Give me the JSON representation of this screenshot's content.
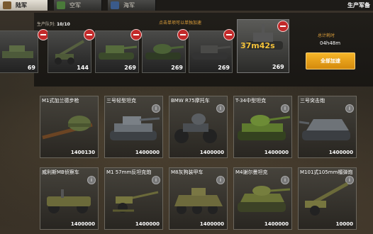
{
  "tabs": [
    {
      "label": "陆军",
      "active": true
    },
    {
      "label": "空军",
      "active": false
    },
    {
      "label": "海军",
      "active": false
    }
  ],
  "title": "生产军备",
  "queue": {
    "count_label": "生产队列:",
    "count_value": "10/10",
    "hint": "点击单项可以单独加速",
    "slots": [
      {
        "count": "69"
      },
      {
        "count": "144"
      },
      {
        "count": "269"
      },
      {
        "count": "269"
      },
      {
        "count": "269"
      }
    ],
    "active": {
      "timer": "37m42s",
      "count": "269"
    },
    "total_label": "总计耗时",
    "total_value": "04h48m",
    "speed_all_label": "全部加速"
  },
  "units": [
    {
      "name": "M1式加兰德步枪",
      "price": "1400130",
      "icon": "rifle-helmet-icon"
    },
    {
      "name": "三号轻型坦克",
      "price": "1400000",
      "icon": "light-tank-icon"
    },
    {
      "name": "BMW R75摩托车",
      "price": "1400000",
      "icon": "motorcycle-icon"
    },
    {
      "name": "T-34中型坦克",
      "price": "1400000",
      "icon": "medium-tank-icon"
    },
    {
      "name": "三号突击炮",
      "price": "1400000",
      "icon": "assault-gun-icon"
    },
    {
      "name": "威利斯MB侦察车",
      "price": "1400000",
      "icon": "jeep-icon"
    },
    {
      "name": "M1 57mm反坦克炮",
      "price": "1400000",
      "icon": "anti-tank-gun-icon"
    },
    {
      "name": "M8灰狗装甲车",
      "price": "1400000",
      "icon": "armored-car-icon"
    },
    {
      "name": "M4谢尔曼坦克",
      "price": "1400000",
      "icon": "sherman-tank-icon"
    },
    {
      "name": "M101式105mm榴弹炮",
      "price": "10000",
      "icon": "howitzer-icon"
    }
  ],
  "info_glyph": "i",
  "colors": {
    "accent": "#e1a23b",
    "button": "#f0a81e",
    "remove": "#c22a2a"
  }
}
